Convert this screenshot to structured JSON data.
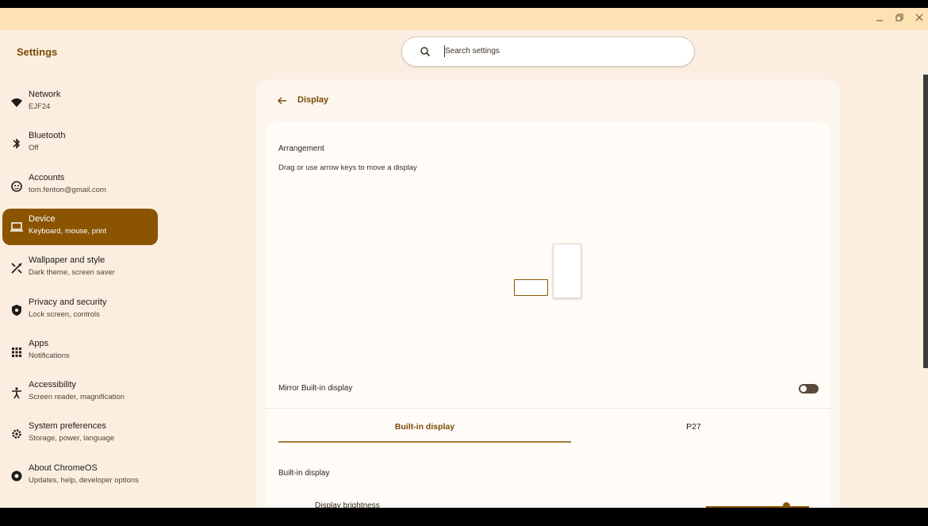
{
  "window": {
    "controls": [
      "minimize",
      "restore",
      "close"
    ]
  },
  "app": {
    "title": "Settings"
  },
  "search": {
    "placeholder": "Search settings"
  },
  "nav": {
    "items": [
      {
        "label": "Network",
        "sub": "EJF24",
        "icon": "wifi-icon"
      },
      {
        "label": "Bluetooth",
        "sub": "Off",
        "icon": "bluetooth-icon"
      },
      {
        "label": "Accounts",
        "sub": "tom.fenton@gmail.com",
        "icon": "account-icon"
      },
      {
        "label": "Device",
        "sub": "Keyboard, mouse, print",
        "icon": "laptop-icon",
        "active": true
      },
      {
        "label": "Wallpaper and style",
        "sub": "Dark theme, screen saver",
        "icon": "palette-icon"
      },
      {
        "label": "Privacy and security",
        "sub": "Lock screen, controls",
        "icon": "shield-icon"
      },
      {
        "label": "Apps",
        "sub": "Notifications",
        "icon": "apps-grid-icon"
      },
      {
        "label": "Accessibility",
        "sub": "Screen reader, magnification",
        "icon": "accessibility-icon"
      },
      {
        "label": "System preferences",
        "sub": "Storage, power, language",
        "icon": "gear-icon"
      },
      {
        "label": "About ChromeOS",
        "sub": "Updates, help, developer options",
        "icon": "chromeos-icon"
      }
    ]
  },
  "page": {
    "title": "Display",
    "arrangement": {
      "title": "Arrangement",
      "subtitle": "Drag or use arrow keys to move a display"
    },
    "mirror": {
      "label": "Mirror Built-in display",
      "enabled": false
    },
    "tabs": [
      {
        "label": "Built-in display",
        "active": true
      },
      {
        "label": "P27",
        "active": false
      }
    ],
    "section": {
      "title": "Built-in display",
      "brightness_label": "Display brightness",
      "brightness_level": 0.78
    }
  },
  "colors": {
    "accent": "#8a5400",
    "titlebar": "#fde3b3",
    "background": "#fbeee1"
  }
}
